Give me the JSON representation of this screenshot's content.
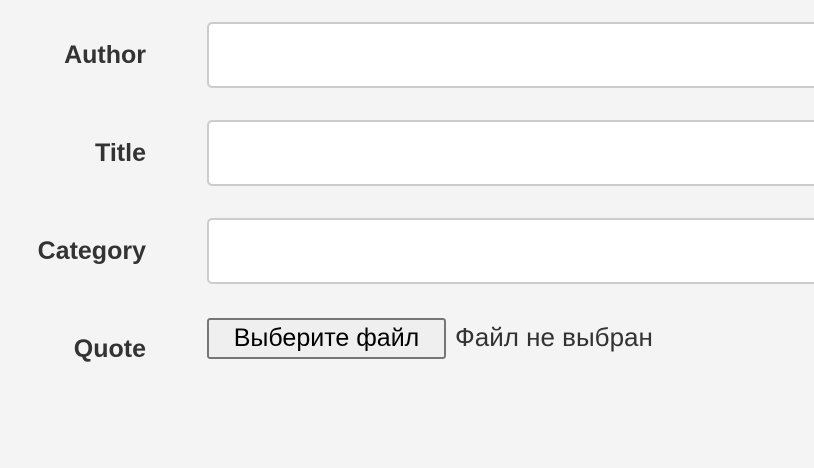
{
  "form": {
    "fields": {
      "author": {
        "label": "Author",
        "value": "",
        "placeholder": ""
      },
      "title": {
        "label": "Title",
        "value": "",
        "placeholder": ""
      },
      "category": {
        "label": "Category",
        "value": "",
        "placeholder": ""
      },
      "quote": {
        "label": "Quote",
        "button_label": "Выберите файл",
        "status_text": "Файл не выбран"
      }
    }
  },
  "colors": {
    "background": "#f4f4f4",
    "label_text": "#333333",
    "input_border": "#cccccc",
    "input_background": "#ffffff",
    "file_button_background": "#efefef",
    "file_button_border": "#767676"
  }
}
